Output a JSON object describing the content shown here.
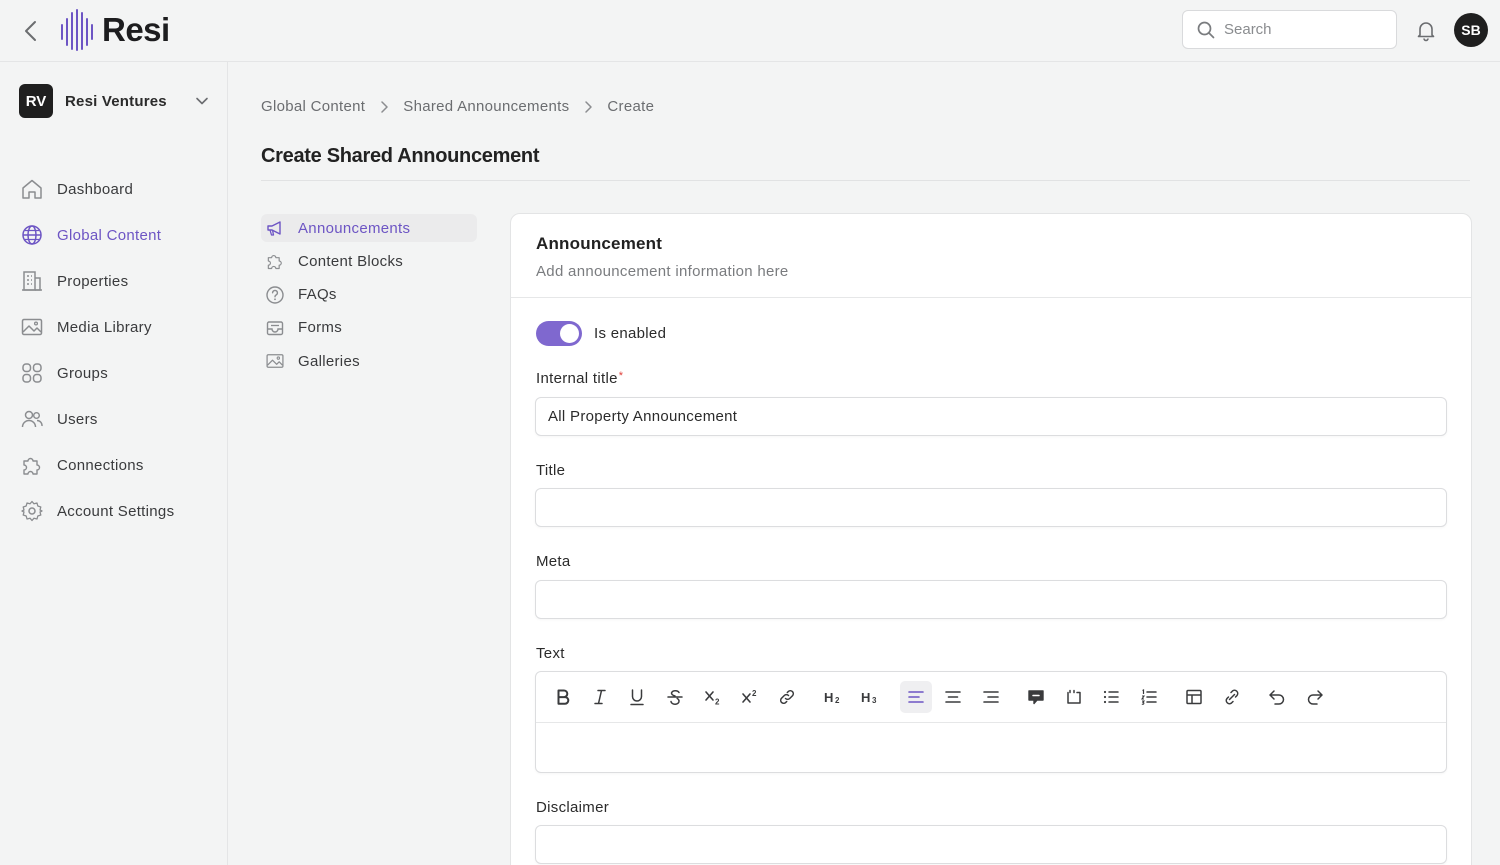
{
  "app": {
    "name": "Resi"
  },
  "header": {
    "search_placeholder": "Search",
    "avatar_initials": "SB"
  },
  "org": {
    "initials": "RV",
    "name": "Resi Ventures"
  },
  "sidebar": {
    "items": [
      {
        "label": "Dashboard",
        "icon": "home-icon"
      },
      {
        "label": "Global Content",
        "icon": "globe-icon",
        "active": true
      },
      {
        "label": "Properties",
        "icon": "building-icon"
      },
      {
        "label": "Media Library",
        "icon": "image-icon"
      },
      {
        "label": "Groups",
        "icon": "grid-icon"
      },
      {
        "label": "Users",
        "icon": "users-icon"
      },
      {
        "label": "Connections",
        "icon": "puzzle-icon"
      },
      {
        "label": "Account Settings",
        "icon": "gear-icon"
      }
    ]
  },
  "breadcrumb": [
    "Global Content",
    "Shared Announcements",
    "Create"
  ],
  "page": {
    "title": "Create Shared Announcement"
  },
  "subnav": {
    "items": [
      {
        "label": "Announcements",
        "icon": "megaphone-icon",
        "active": true
      },
      {
        "label": "Content Blocks",
        "icon": "puzzle-icon"
      },
      {
        "label": "FAQs",
        "icon": "question-icon"
      },
      {
        "label": "Forms",
        "icon": "inbox-icon"
      },
      {
        "label": "Galleries",
        "icon": "image-icon"
      }
    ]
  },
  "form": {
    "card_title": "Announcement",
    "card_subtitle": "Add announcement information here",
    "toggle_label": "Is enabled",
    "toggle_on": true,
    "internal_title_label": "Internal title",
    "required_mark": "*",
    "internal_title_value": "All Property Announcement",
    "title_label": "Title",
    "title_value": "",
    "meta_label": "Meta",
    "meta_value": "",
    "text_label": "Text",
    "disclaimer_label": "Disclaimer",
    "disclaimer_value": ""
  },
  "editor_toolbar": [
    "bold-icon",
    "italic-icon",
    "underline-icon",
    "strikethrough-icon",
    "subscript-icon",
    "superscript-icon",
    "link-icon",
    "heading2-icon",
    "heading3-icon",
    "align-left-icon",
    "align-center-icon",
    "align-right-icon",
    "comment-icon",
    "embed-icon",
    "bullet-list-icon",
    "numbered-list-icon",
    "table-icon",
    "attach-link-icon",
    "undo-icon",
    "redo-icon"
  ],
  "colors": {
    "accent": "#6d55c4",
    "toggle": "#7f68cf",
    "dark": "#1f1f1f",
    "required": "#e0403a"
  }
}
